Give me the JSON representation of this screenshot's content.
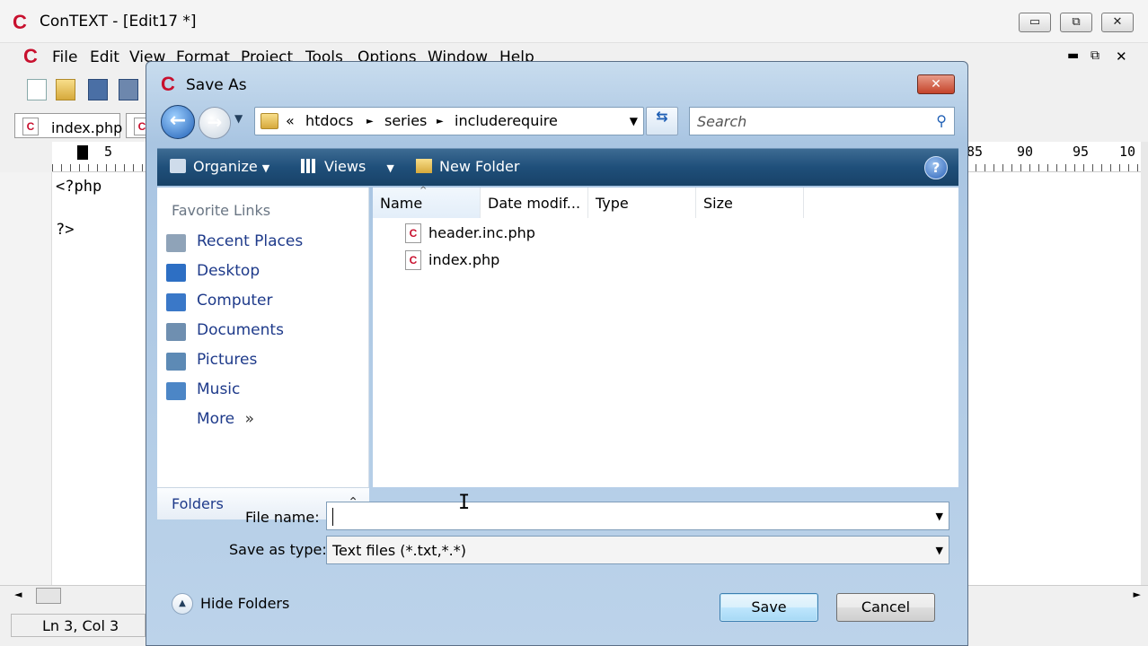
{
  "app": {
    "title": "ConTEXT - [Edit17 *]",
    "logo": "C",
    "caption_buttons": {
      "minimize": "▭",
      "restore": "⧉",
      "close": "✕"
    },
    "mdi_buttons": {
      "minimize": "▬",
      "restore": "⧉",
      "close": "✕"
    }
  },
  "menu": [
    "File",
    "Edit",
    "View",
    "Format",
    "Project",
    "Tools",
    "Options",
    "Window",
    "Help"
  ],
  "editor": {
    "tab_label": "index.php",
    "ruler_left": "5",
    "ruler_right": [
      "85",
      "90",
      "95",
      "10"
    ],
    "lines": [
      "<?php",
      "",
      "?>"
    ],
    "status_position": "Ln 3, Col 3"
  },
  "dialog": {
    "title": "Save As",
    "logo": "C",
    "close": "✕",
    "nav": {
      "back": "←",
      "forward": "→",
      "dropdown": "▼"
    },
    "address": {
      "prefix": "«",
      "crumbs": [
        "htdocs",
        "series",
        "includerequire"
      ],
      "separator": "►",
      "dropdown": "▼"
    },
    "refresh": "⇆",
    "search_placeholder": "Search",
    "search_icon": "magnifier-icon",
    "commands": {
      "organize": "Organize",
      "views": "Views",
      "new_folder": "New Folder",
      "arrow": "▼",
      "help": "?"
    },
    "favorite_links_header": "Favorite Links",
    "favorite_links": [
      {
        "label": "Recent Places",
        "icon": "recent-places-icon",
        "color": "#8fa3b8"
      },
      {
        "label": "Desktop",
        "icon": "desktop-icon",
        "color": "#2d6fc4"
      },
      {
        "label": "Computer",
        "icon": "computer-icon",
        "color": "#3a78c8"
      },
      {
        "label": "Documents",
        "icon": "documents-icon",
        "color": "#6f8fb0"
      },
      {
        "label": "Pictures",
        "icon": "pictures-icon",
        "color": "#5d8ab5"
      },
      {
        "label": "Music",
        "icon": "music-icon",
        "color": "#4c86c6"
      }
    ],
    "more_label": "More",
    "more_chevron": "»",
    "folders_label": "Folders",
    "folders_chevron": "⌃",
    "columns": [
      "Name",
      "Date modif...",
      "Type",
      "Size"
    ],
    "sort_indicator": "^",
    "files": [
      "header.inc.php",
      "index.php"
    ],
    "file_name_label": "File name:",
    "file_name_value": "",
    "save_type_label": "Save as type:",
    "save_type_value": "Text files (*.txt,*.*)",
    "hide_folders": "Hide Folders",
    "save_button": "Save",
    "cancel_button": "Cancel"
  },
  "colors": {
    "accent": "#c8102e",
    "link": "#1e3a8a",
    "cmdbar": "#1f4f7a"
  }
}
